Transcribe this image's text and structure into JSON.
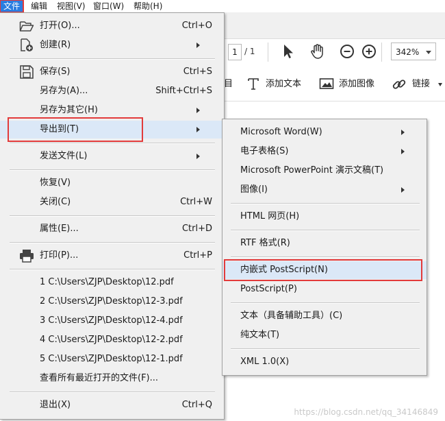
{
  "menubar": {
    "file": "文件",
    "edit": "编辑",
    "view": "视图(V)",
    "window": "窗口(W)",
    "help": "帮助(H)"
  },
  "toolbar": {
    "page_current": "1",
    "page_total": "/ 1",
    "zoom": "342%"
  },
  "edit_tools": {
    "partial_label": "目",
    "add_text": "添加文本",
    "add_image": "添加图像",
    "link": "链接"
  },
  "file_menu": {
    "open": "打开(O)...",
    "open_shortcut": "Ctrl+O",
    "create": "创建(R)",
    "save": "保存(S)",
    "save_shortcut": "Ctrl+S",
    "save_as": "另存为(A)...",
    "save_as_shortcut": "Shift+Ctrl+S",
    "save_as_other": "另存为其它(H)",
    "export_to": "导出到(T)",
    "send_file": "发送文件(L)",
    "revert": "恢复(V)",
    "close": "关闭(C)",
    "close_shortcut": "Ctrl+W",
    "properties": "属性(E)...",
    "properties_shortcut": "Ctrl+D",
    "print": "打印(P)...",
    "print_shortcut": "Ctrl+P",
    "recent_files": [
      "1 C:\\Users\\ZJP\\Desktop\\12.pdf",
      "2 C:\\Users\\ZJP\\Desktop\\12-3.pdf",
      "3 C:\\Users\\ZJP\\Desktop\\12-4.pdf",
      "4 C:\\Users\\ZJP\\Desktop\\12-2.pdf",
      "5 C:\\Users\\ZJP\\Desktop\\12-1.pdf"
    ],
    "view_all_recent": "查看所有最近打开的文件(F)...",
    "exit": "退出(X)",
    "exit_shortcut": "Ctrl+Q"
  },
  "export_menu": {
    "word": "Microsoft Word(W)",
    "spreadsheet": "电子表格(S)",
    "powerpoint": "Microsoft PowerPoint 演示文稿(T)",
    "image": "图像(I)",
    "html": "HTML 网页(H)",
    "rtf": "RTF 格式(R)",
    "embedded_postscript": "内嵌式 PostScript(N)",
    "postscript": "PostScript(P)",
    "text_accessible": "文本（具备辅助工具）(C)",
    "plain_text": "纯文本(T)",
    "xml": "XML 1.0(X)"
  },
  "watermark": "https://blog.csdn.net/qq_34146849",
  "colors": {
    "menu_bg": "#f0f0f0",
    "highlight": "#dbe8f7",
    "annotation_red": "#e23a3a",
    "menubar_active": "#2a7de1"
  }
}
